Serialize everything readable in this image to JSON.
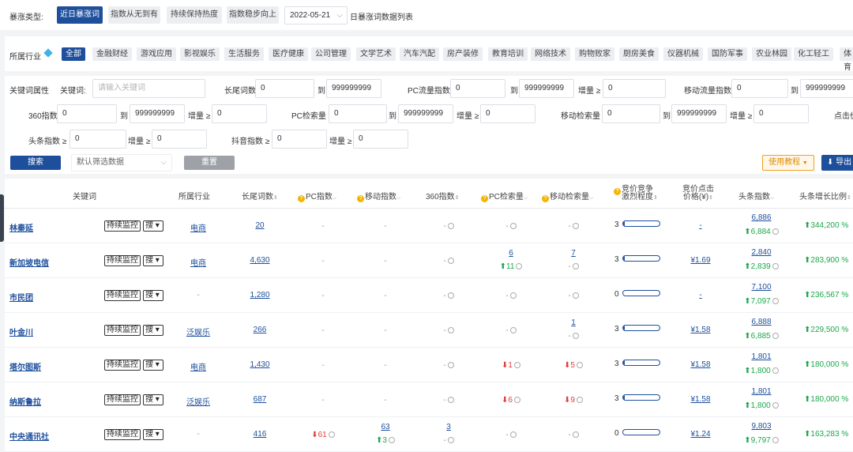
{
  "top": {
    "label": "暴涨类型:",
    "types": [
      "近日暴涨词",
      "指数从无到有",
      "持续保持热度",
      "指数稳步向上"
    ],
    "date": "2022-05-21",
    "list_title": "日暴涨词数据列表"
  },
  "industry": {
    "label": "所属行业",
    "items": [
      "全部",
      "金融财经",
      "游戏应用",
      "影视娱乐",
      "生活服务",
      "医疗健康",
      "公司管理",
      "文学艺术",
      "汽车汽配",
      "房产装修",
      "教育培训",
      "网络技术",
      "购物败家",
      "厨房美食",
      "仪器机械",
      "国防军事",
      "农业林园",
      "化工轻工",
      "体育"
    ]
  },
  "filters": {
    "attr_label": "关键词属性",
    "keyword_label": "关键词:",
    "keyword_placeholder": "请输入关键词",
    "to": "到",
    "inc": "增量 ≥",
    "long_tail": {
      "label": "长尾词数",
      "min": "0",
      "max": "999999999"
    },
    "pc_flow": {
      "label": "PC流量指数",
      "min": "0",
      "max": "999999999",
      "inc": "0"
    },
    "mobile_flow": {
      "label": "移动流量指数",
      "min": "0",
      "max": "999999999"
    },
    "i360": {
      "label": "360指数",
      "min": "0",
      "max": "999999999",
      "inc": "0"
    },
    "pc_search": {
      "label": "PC检索量",
      "min": "0",
      "max": "999999999",
      "inc": "0"
    },
    "mobile_search": {
      "label": "移动检索量",
      "min": "0",
      "max": "999999999",
      "inc": "0"
    },
    "click_cut": "点击价",
    "toutiao": {
      "label": "头条指数 ≥",
      "min": "0",
      "inc": "0"
    },
    "douyin": {
      "label": "抖音指数 ≥",
      "min": "0",
      "inc": "0"
    }
  },
  "actions": {
    "search": "搜索",
    "preset": "默认筛选数据",
    "reset": "重置",
    "tutorial": "使用教程",
    "export": "导出"
  },
  "columns": {
    "keyword": "关键词",
    "industry": "所属行业",
    "long_tail": "长尾词数",
    "pc_index": "PC指数",
    "mobile_index": "移动指数",
    "i360": "360指数",
    "pc_search": "PC检索量",
    "mobile_search": "移动检索量",
    "competition_1": "竞价竞争",
    "competition_2": "激烈程度",
    "price_1": "竞价点击",
    "price_2": "价格(¥)",
    "toutiao": "头条指数",
    "growth": "头条增长比例"
  },
  "row_buttons": {
    "monitor": "持续监控",
    "search": "搜"
  },
  "colors": {
    "brand": "#1d4f9c",
    "up": "#1aa84a",
    "down": "#e23b3b",
    "accent": "#f4b400"
  },
  "rows": [
    {
      "kw": "林秦延",
      "ind": "电商",
      "lt": "20",
      "pc": "-",
      "mob": "-",
      "i360": "-",
      "pcs": "-",
      "pcs_d": "",
      "ms": "-",
      "ms_d": "",
      "comp": "3",
      "comp_level": 0.05,
      "price": "-",
      "tt": "6,886",
      "tt_d": "6,884",
      "gr": "344,200 %"
    },
    {
      "kw": "新加坡电信",
      "ind": "电商",
      "lt": "4,630",
      "pc": "-",
      "mob": "-",
      "i360": "-",
      "pcs": "6",
      "pcs_d": "11",
      "ms": "7",
      "ms_d": "-",
      "comp": "3",
      "comp_level": 0.05,
      "price": "¥1.69",
      "tt": "2,840",
      "tt_d": "2,839",
      "gr": "283,900 %"
    },
    {
      "kw": "市民团",
      "ind": "-",
      "lt": "1,280",
      "pc": "-",
      "mob": "-",
      "i360": "-",
      "pcs": "-",
      "pcs_d": "",
      "ms": "-",
      "ms_d": "",
      "comp": "0",
      "comp_level": 0,
      "price": "-",
      "tt": "7,100",
      "tt_d": "7,097",
      "gr": "236,567 %"
    },
    {
      "kw": "叶金川",
      "ind": "泛娱乐",
      "lt": "266",
      "pc": "-",
      "mob": "-",
      "i360": "-",
      "pcs": "-",
      "pcs_d": "",
      "ms": "1",
      "ms_d": "-",
      "comp": "3",
      "comp_level": 0.05,
      "price": "¥1.58",
      "tt": "6,888",
      "tt_d": "6,885",
      "gr": "229,500 %"
    },
    {
      "kw": "塔尔图斯",
      "ind": "电商",
      "lt": "1,430",
      "pc": "-",
      "mob": "-",
      "i360": "-",
      "pcs": "1",
      "pcs_dir": "down",
      "ms": "5",
      "ms_dir": "down",
      "comp": "3",
      "comp_level": 0.05,
      "price": "¥1.58",
      "tt": "1,801",
      "tt_d": "1,800",
      "gr": "180,000 %"
    },
    {
      "kw": "纳斯鲁拉",
      "ind": "泛娱乐",
      "lt": "687",
      "pc": "-",
      "mob": "-",
      "i360": "-",
      "pcs": "6",
      "pcs_dir": "down",
      "ms": "9",
      "ms_dir": "down",
      "comp": "3",
      "comp_level": 0.05,
      "price": "¥1.58",
      "tt": "1,801",
      "tt_d": "1,800",
      "gr": "180,000 %"
    },
    {
      "kw": "中央通讯社",
      "ind": "-",
      "lt": "416",
      "pc": "61",
      "pc_dir": "down",
      "mob": "63",
      "mob_d": "3",
      "i360": "3",
      "i360_d": "-",
      "pcs": "-",
      "ms": "-",
      "comp": "0",
      "comp_level": 0,
      "price": "¥1.24",
      "tt": "9,803",
      "tt_d": "9,797",
      "gr": "163,283 %"
    }
  ]
}
